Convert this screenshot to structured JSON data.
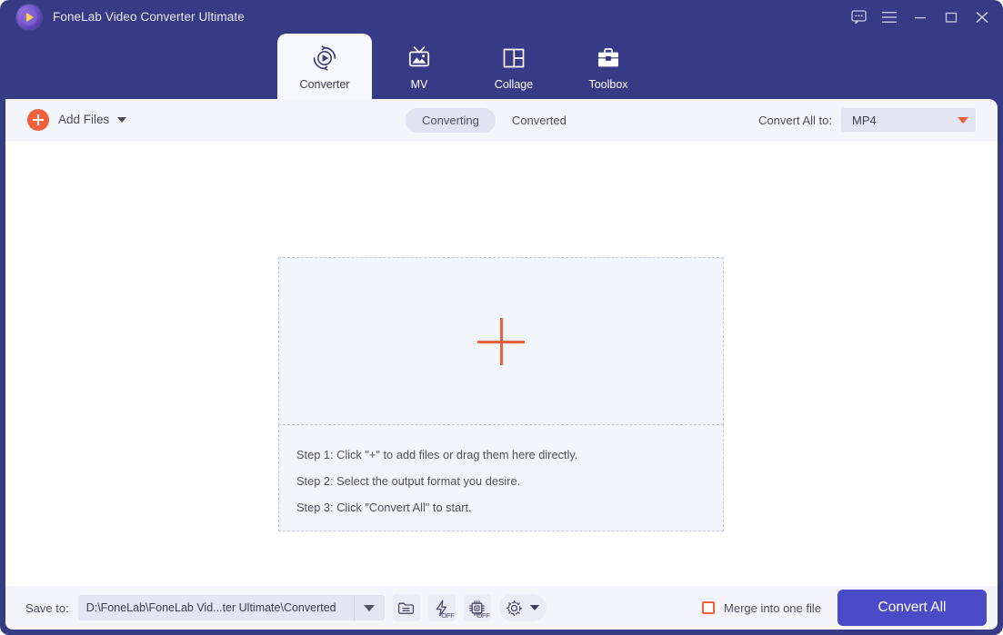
{
  "window": {
    "title": "FoneLab Video Converter Ultimate",
    "logo_icon": "fonelab-play-logo",
    "controls": [
      {
        "name": "feedback-icon",
        "label": "Feedback"
      },
      {
        "name": "menu-icon",
        "label": "Menu"
      },
      {
        "name": "minimize-icon",
        "label": "Minimize"
      },
      {
        "name": "maximize-icon",
        "label": "Maximize"
      },
      {
        "name": "close-icon",
        "label": "Close"
      }
    ]
  },
  "nav": {
    "tabs": [
      {
        "label": "Converter",
        "icon": "converter-icon",
        "active": true
      },
      {
        "label": "MV",
        "icon": "mv-icon",
        "active": false
      },
      {
        "label": "Collage",
        "icon": "collage-icon",
        "active": false
      },
      {
        "label": "Toolbox",
        "icon": "toolbox-icon",
        "active": false
      }
    ]
  },
  "toolbar": {
    "add_files_label": "Add Files",
    "add_files_icon": "plus-circle-icon",
    "add_files_caret": "chevron-down-icon",
    "segments": [
      {
        "label": "Converting",
        "active": true
      },
      {
        "label": "Converted",
        "active": false
      }
    ],
    "convert_all_to_label": "Convert All to:",
    "format_value": "MP4",
    "format_caret": "caret-down-icon"
  },
  "main": {
    "dropzone_plus_icon": "plus-icon",
    "steps": [
      "Step 1: Click \"+\" to add files or drag them here directly.",
      "Step 2: Select the output format you desire.",
      "Step 3: Click \"Convert All\" to start."
    ]
  },
  "bottom": {
    "save_to_label": "Save to:",
    "save_path": "D:\\FoneLab\\FoneLab Vid...ter Ultimate\\Converted",
    "path_caret": "caret-down-icon",
    "icons": [
      {
        "name": "open-folder-icon",
        "badge": ""
      },
      {
        "name": "hardware-acceleration-icon",
        "badge": "OFF"
      },
      {
        "name": "gpu-chip-icon",
        "badge": "OFF"
      },
      {
        "name": "settings-gear-icon",
        "badge": ""
      }
    ],
    "merge_label": "Merge into one file",
    "merge_checked": false,
    "convert_all_label": "Convert All"
  },
  "colors": {
    "frame": "#373a85",
    "accent_orange": "#f1603c",
    "accent_indigo": "#4b4bc8",
    "toolbar_bg": "#f4f5fa",
    "dropzone_bg": "#f2f5fa",
    "pill_active_bg": "#e2e2f2"
  }
}
